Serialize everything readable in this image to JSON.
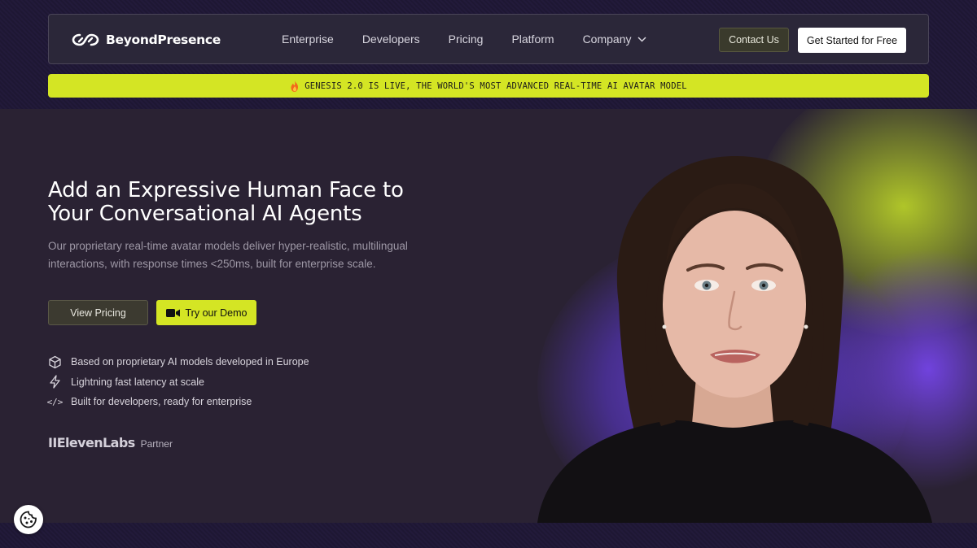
{
  "brand": {
    "name": "BeyondPresence",
    "logo_icon": "infinity-link-icon"
  },
  "nav": {
    "links": [
      {
        "label": "Enterprise"
      },
      {
        "label": "Developers"
      },
      {
        "label": "Pricing"
      },
      {
        "label": "Platform"
      },
      {
        "label": "Company"
      }
    ],
    "contact_label": "Contact Us",
    "get_started_label": "Get Started for Free"
  },
  "banner": {
    "icon": "fire-icon",
    "text": "GENESIS 2.0 IS LIVE, THE WORLD'S MOST ADVANCED REAL-TIME AI AVATAR MODEL"
  },
  "hero": {
    "title_line1": "Add an Expressive Human Face to",
    "title_line2": "Your Conversational AI Agents",
    "subtitle_line1": "Our proprietary real-time avatar models deliver hyper-realistic, multilingual",
    "subtitle_line2": "interactions, with response times <250ms, built for enterprise scale.",
    "view_pricing_label": "View Pricing",
    "demo_label": "Try our Demo",
    "features": [
      {
        "icon": "cube-icon",
        "text": "Based on proprietary AI models developed in Europe"
      },
      {
        "icon": "lightning-icon",
        "text": "Lightning fast latency at scale"
      },
      {
        "icon": "code-icon",
        "glyph": "</>",
        "text": "Built for developers, ready for enterprise"
      }
    ],
    "partner_brand": "IIElevenLabs",
    "partner_label": "Partner"
  },
  "colors": {
    "accent_lime": "#d4e524",
    "background": "#1c1630",
    "hero_bg": "#2a2233",
    "glow_purple": "#7046e6"
  }
}
